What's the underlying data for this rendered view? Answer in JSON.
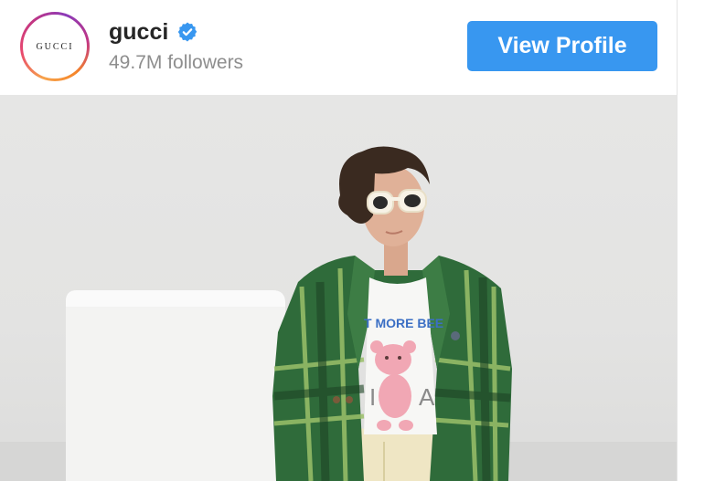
{
  "header": {
    "avatar_text": "GUCCI",
    "username": "gucci",
    "verified_icon": "verified-badge-icon",
    "followers": "49.7M followers",
    "view_profile_label": "View Profile"
  },
  "post": {
    "shirt_text": "T MORE BEE"
  },
  "colors": {
    "accent_blue": "#3897f0",
    "verified_blue": "#3897f0",
    "username": "#262626",
    "followers": "#8e8e8e"
  }
}
